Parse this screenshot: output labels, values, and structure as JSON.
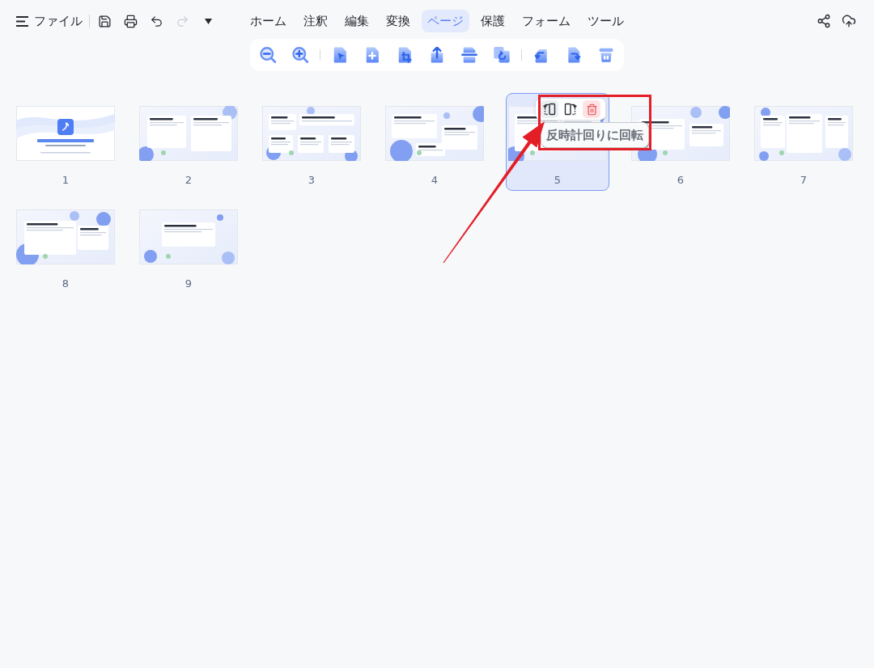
{
  "file_menu": {
    "label": "ファイル"
  },
  "quick_actions": [
    {
      "kind": "save",
      "disabled": false
    },
    {
      "kind": "print",
      "disabled": false
    },
    {
      "kind": "undo",
      "disabled": false
    },
    {
      "kind": "redo",
      "disabled": true
    },
    {
      "kind": "more",
      "disabled": false
    }
  ],
  "tabs": [
    {
      "label": "ホーム",
      "selected": false
    },
    {
      "label": "注釈",
      "selected": false
    },
    {
      "label": "編集",
      "selected": false
    },
    {
      "label": "変換",
      "selected": false
    },
    {
      "label": "ページ",
      "selected": true
    },
    {
      "label": "保護",
      "selected": false
    },
    {
      "label": "フォーム",
      "selected": false
    },
    {
      "label": "ツール",
      "selected": false
    }
  ],
  "header_actions": [
    {
      "kind": "share"
    },
    {
      "kind": "upload"
    }
  ],
  "page_toolbar": [
    {
      "items": [
        {
          "kind": "zoomout"
        },
        {
          "kind": "zoomin"
        }
      ]
    },
    {
      "items": [
        {
          "kind": "select"
        },
        {
          "kind": "insert"
        },
        {
          "kind": "crop"
        },
        {
          "kind": "extract"
        },
        {
          "kind": "split"
        },
        {
          "kind": "replace"
        }
      ]
    },
    {
      "items": [
        {
          "kind": "rotateleft"
        },
        {
          "kind": "rotateright"
        },
        {
          "kind": "delete"
        }
      ]
    }
  ],
  "pages": [
    {
      "number": "1",
      "selected": false
    },
    {
      "number": "2",
      "selected": false
    },
    {
      "number": "3",
      "selected": false
    },
    {
      "number": "4",
      "selected": false
    },
    {
      "number": "5",
      "selected": true,
      "actions": [
        {
          "kind": "rotateleft",
          "hovered": true
        },
        {
          "kind": "rotateright",
          "hovered": false
        },
        {
          "kind": "delete",
          "hovered": false
        }
      ],
      "tooltip": "反時計回りに回転"
    },
    {
      "number": "6",
      "selected": false
    },
    {
      "number": "7",
      "selected": false
    },
    {
      "number": "8",
      "selected": false
    },
    {
      "number": "9",
      "selected": false
    }
  ]
}
